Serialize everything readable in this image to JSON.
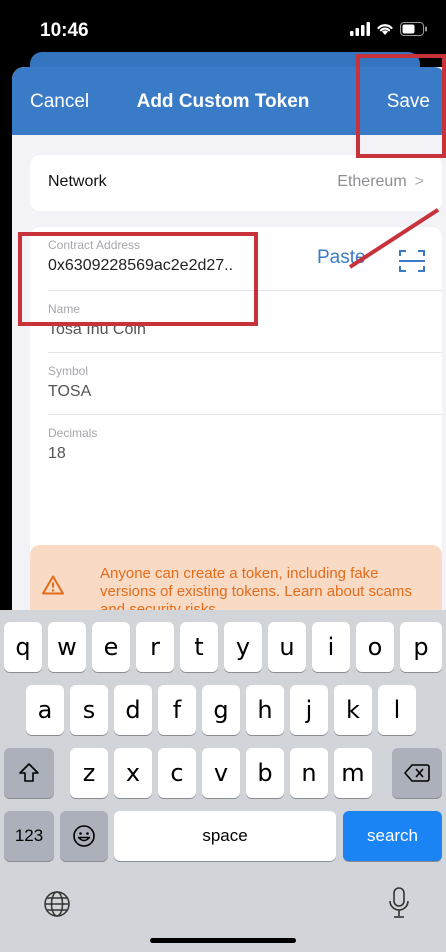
{
  "status_bar": {
    "time": "10:46"
  },
  "nav": {
    "cancel_label": "Cancel",
    "title": "Add Custom Token",
    "save_label": "Save"
  },
  "network": {
    "label": "Network",
    "value": "Ethereum",
    "chevron": ">"
  },
  "fields": {
    "contract": {
      "label": "Contract Address",
      "value": "0x6309228569ac2e2d27..",
      "paste_label": "Paste"
    },
    "name": {
      "label": "Name",
      "value": "Tosa Inu Coin"
    },
    "symbol": {
      "label": "Symbol",
      "value": "TOSA"
    },
    "decimals": {
      "label": "Decimals",
      "value": "18"
    }
  },
  "warning": {
    "text": "Anyone can create a token, including fake versions of existing tokens. Learn about scams and security risks."
  },
  "keyboard": {
    "row1": [
      "q",
      "w",
      "e",
      "r",
      "t",
      "y",
      "u",
      "i",
      "o",
      "p"
    ],
    "row2": [
      "a",
      "s",
      "d",
      "f",
      "g",
      "h",
      "j",
      "k",
      "l"
    ],
    "row3": [
      "z",
      "x",
      "c",
      "v",
      "b",
      "n",
      "m"
    ],
    "numbers_label": "123",
    "space_label": "space",
    "search_label": "search"
  },
  "colors": {
    "accent": "#3a7bc8",
    "warning_bg": "#f9dac4",
    "warning_text": "#e36c1b",
    "highlight": "#c8323b",
    "search_key": "#1a84f4"
  },
  "icons": [
    "signal-icon",
    "wifi-icon",
    "battery-icon",
    "chevron-right-icon",
    "scan-icon",
    "warning-icon",
    "shift-icon",
    "backspace-icon",
    "emoji-icon",
    "globe-icon",
    "microphone-icon"
  ]
}
